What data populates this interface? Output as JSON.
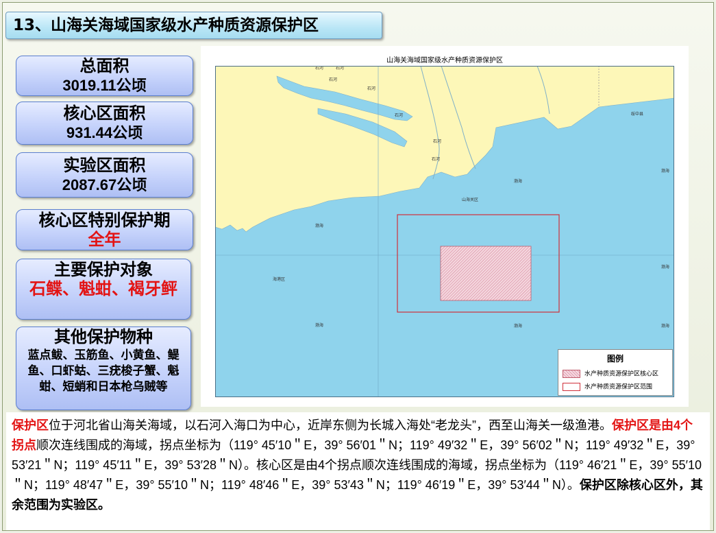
{
  "title": "13、山海关海域国家级水产种质资源保护区",
  "stats": [
    {
      "label": "总面积",
      "value": "3019.11公顷"
    },
    {
      "label": "核心区面积",
      "value": "931.44公顷"
    },
    {
      "label": "实验区面积",
      "value": "2087.67公顷"
    },
    {
      "label": "核心区特别保护期",
      "value": "全年"
    },
    {
      "label": "主要保护对象",
      "value": "石鲽、魁蚶、褐牙鲆"
    },
    {
      "label": "其他保护物种",
      "value": "蓝点鲅、玉筋鱼、小黄鱼、鳀鱼、口虾蛄、三疣梭子蟹、魁蚶、短蛸和日本枪乌贼等"
    }
  ],
  "map": {
    "title": "山海关海域国家级水产种质资源保护区",
    "place_labels": [
      "石河",
      "石河",
      "石河",
      "石河",
      "石河",
      "石河",
      "石河",
      "绥中县",
      "渤海",
      "渤海",
      "渤海",
      "渤海",
      "渤海",
      "渤海",
      "渤海",
      "山海关区",
      "海港区"
    ],
    "legend_title": "图例",
    "legend_items": [
      "水产种质资源保护区核心区",
      "水产种质资源保护区范围"
    ],
    "colors": {
      "sea": "#8fd3ec",
      "land": "#fdf7b8",
      "boundary": "#d0303a",
      "core": "#e8a9b8"
    }
  },
  "description": {
    "p1_red": "保护区",
    "p1_text": "位于河北省山海关海域，以石河入海口为中心，近岸东侧为长城入海处“老龙头”，西至山海关一级渔港。",
    "p2_red": "保护区是由4个拐点",
    "p2_text": "顺次连线围成的海域，拐点坐标为（119° 45′10＂E，39° 56′01＂N；119° 49′32＂E，39° 56′02＂N；119° 49′32＂E，39° 53′21＂N；119° 45′11＂E，39° 53′28＂N）。核心区是由4个拐点顺次连线围成的海域，拐点坐标为（119° 46′21＂E，39° 55′10＂N；119° 48′47＂E，39° 55′10＂N；119° 48′46＂E，39° 53′43＂N；119° 46′19＂E，39° 53′44＂N）。",
    "p3_bold": "保护区除核心区外，其余范围为实验区。"
  }
}
